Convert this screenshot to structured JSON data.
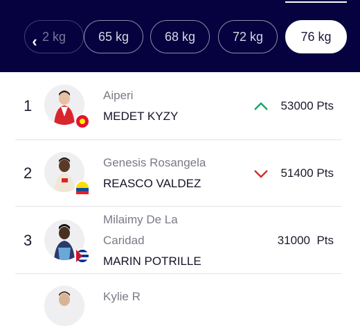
{
  "header": {
    "back_icon": "chevron-left-icon",
    "categories": [
      {
        "label": "2 kg",
        "state": "faded"
      },
      {
        "label": "65 kg",
        "state": "normal"
      },
      {
        "label": "68 kg",
        "state": "normal"
      },
      {
        "label": "72 kg",
        "state": "normal"
      },
      {
        "label": "76 kg",
        "state": "active"
      }
    ]
  },
  "ranking": [
    {
      "rank": "1",
      "first_name": "Aiperi",
      "last_name": "MEDET KYZY",
      "points": "53000 Pts",
      "trend": "up",
      "flag": "kyrgyzstan-flag-icon"
    },
    {
      "rank": "2",
      "first_name": "Genesis Rosangela",
      "last_name": "REASCO VALDEZ",
      "points": "51400 Pts",
      "trend": "down",
      "flag": "ecuador-flag-icon"
    },
    {
      "rank": "3",
      "first_name_line1": "Milaimy De La",
      "first_name_line2": "Caridad",
      "last_name": "MARIN POTRILLE",
      "points": "31000  Pts",
      "trend": "none",
      "flag": "cuba-flag-icon"
    },
    {
      "first_name": "Kylie R"
    }
  ],
  "colors": {
    "header_bg": "#05023f",
    "trend_up": "#1aa66a",
    "trend_down": "#d0332a"
  }
}
